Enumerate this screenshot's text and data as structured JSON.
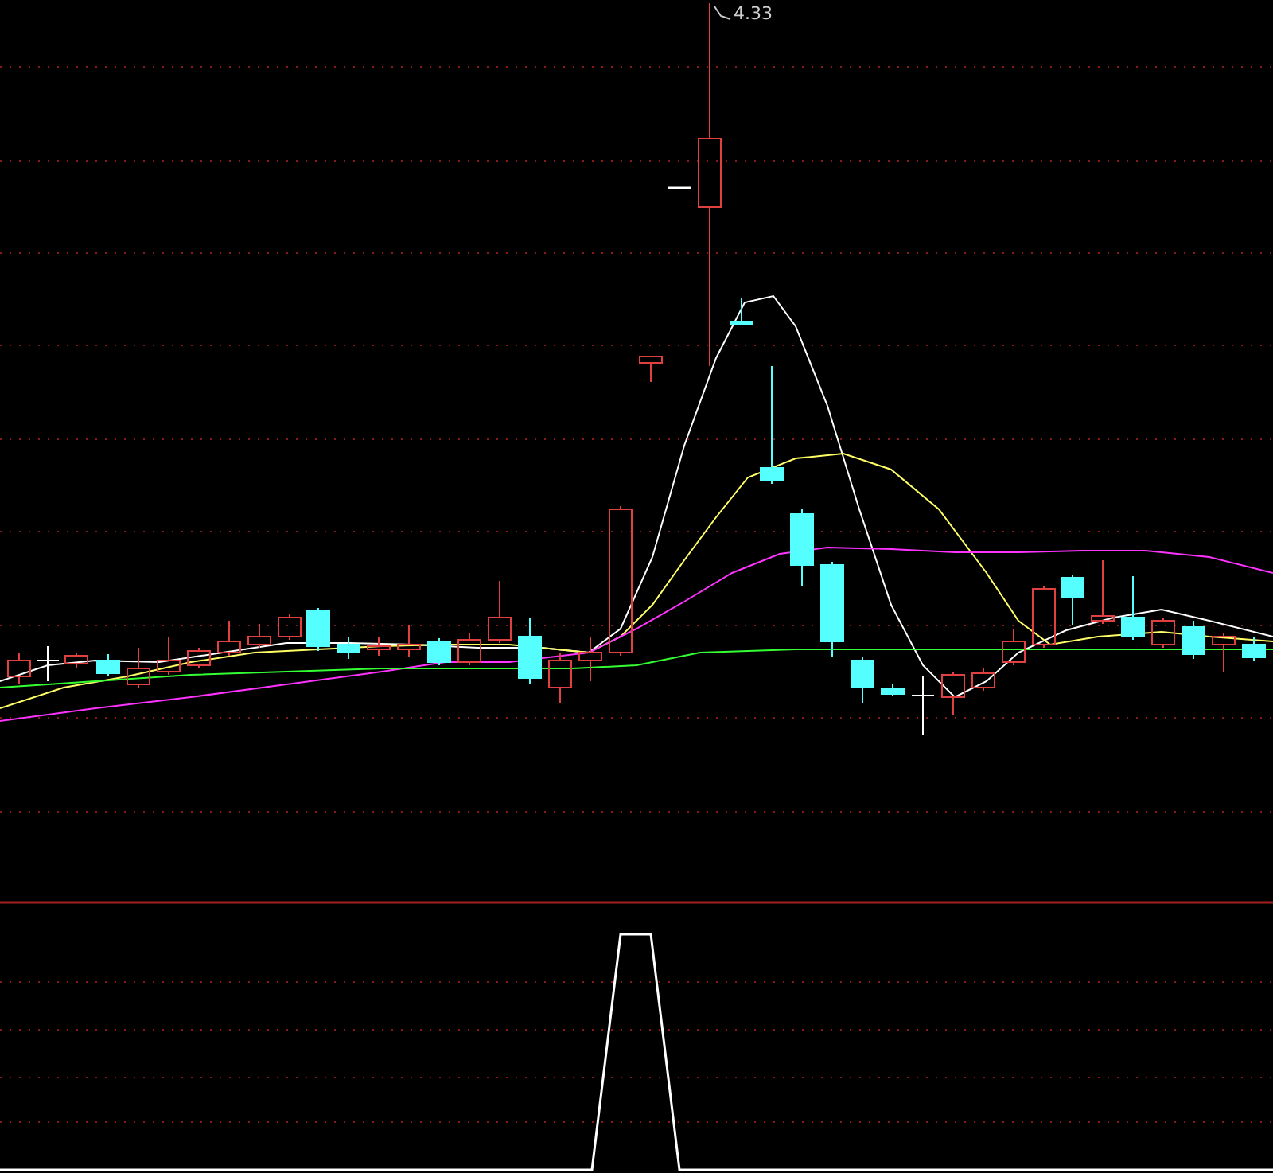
{
  "price_chart": {
    "high_label": "4.33"
  }
}
